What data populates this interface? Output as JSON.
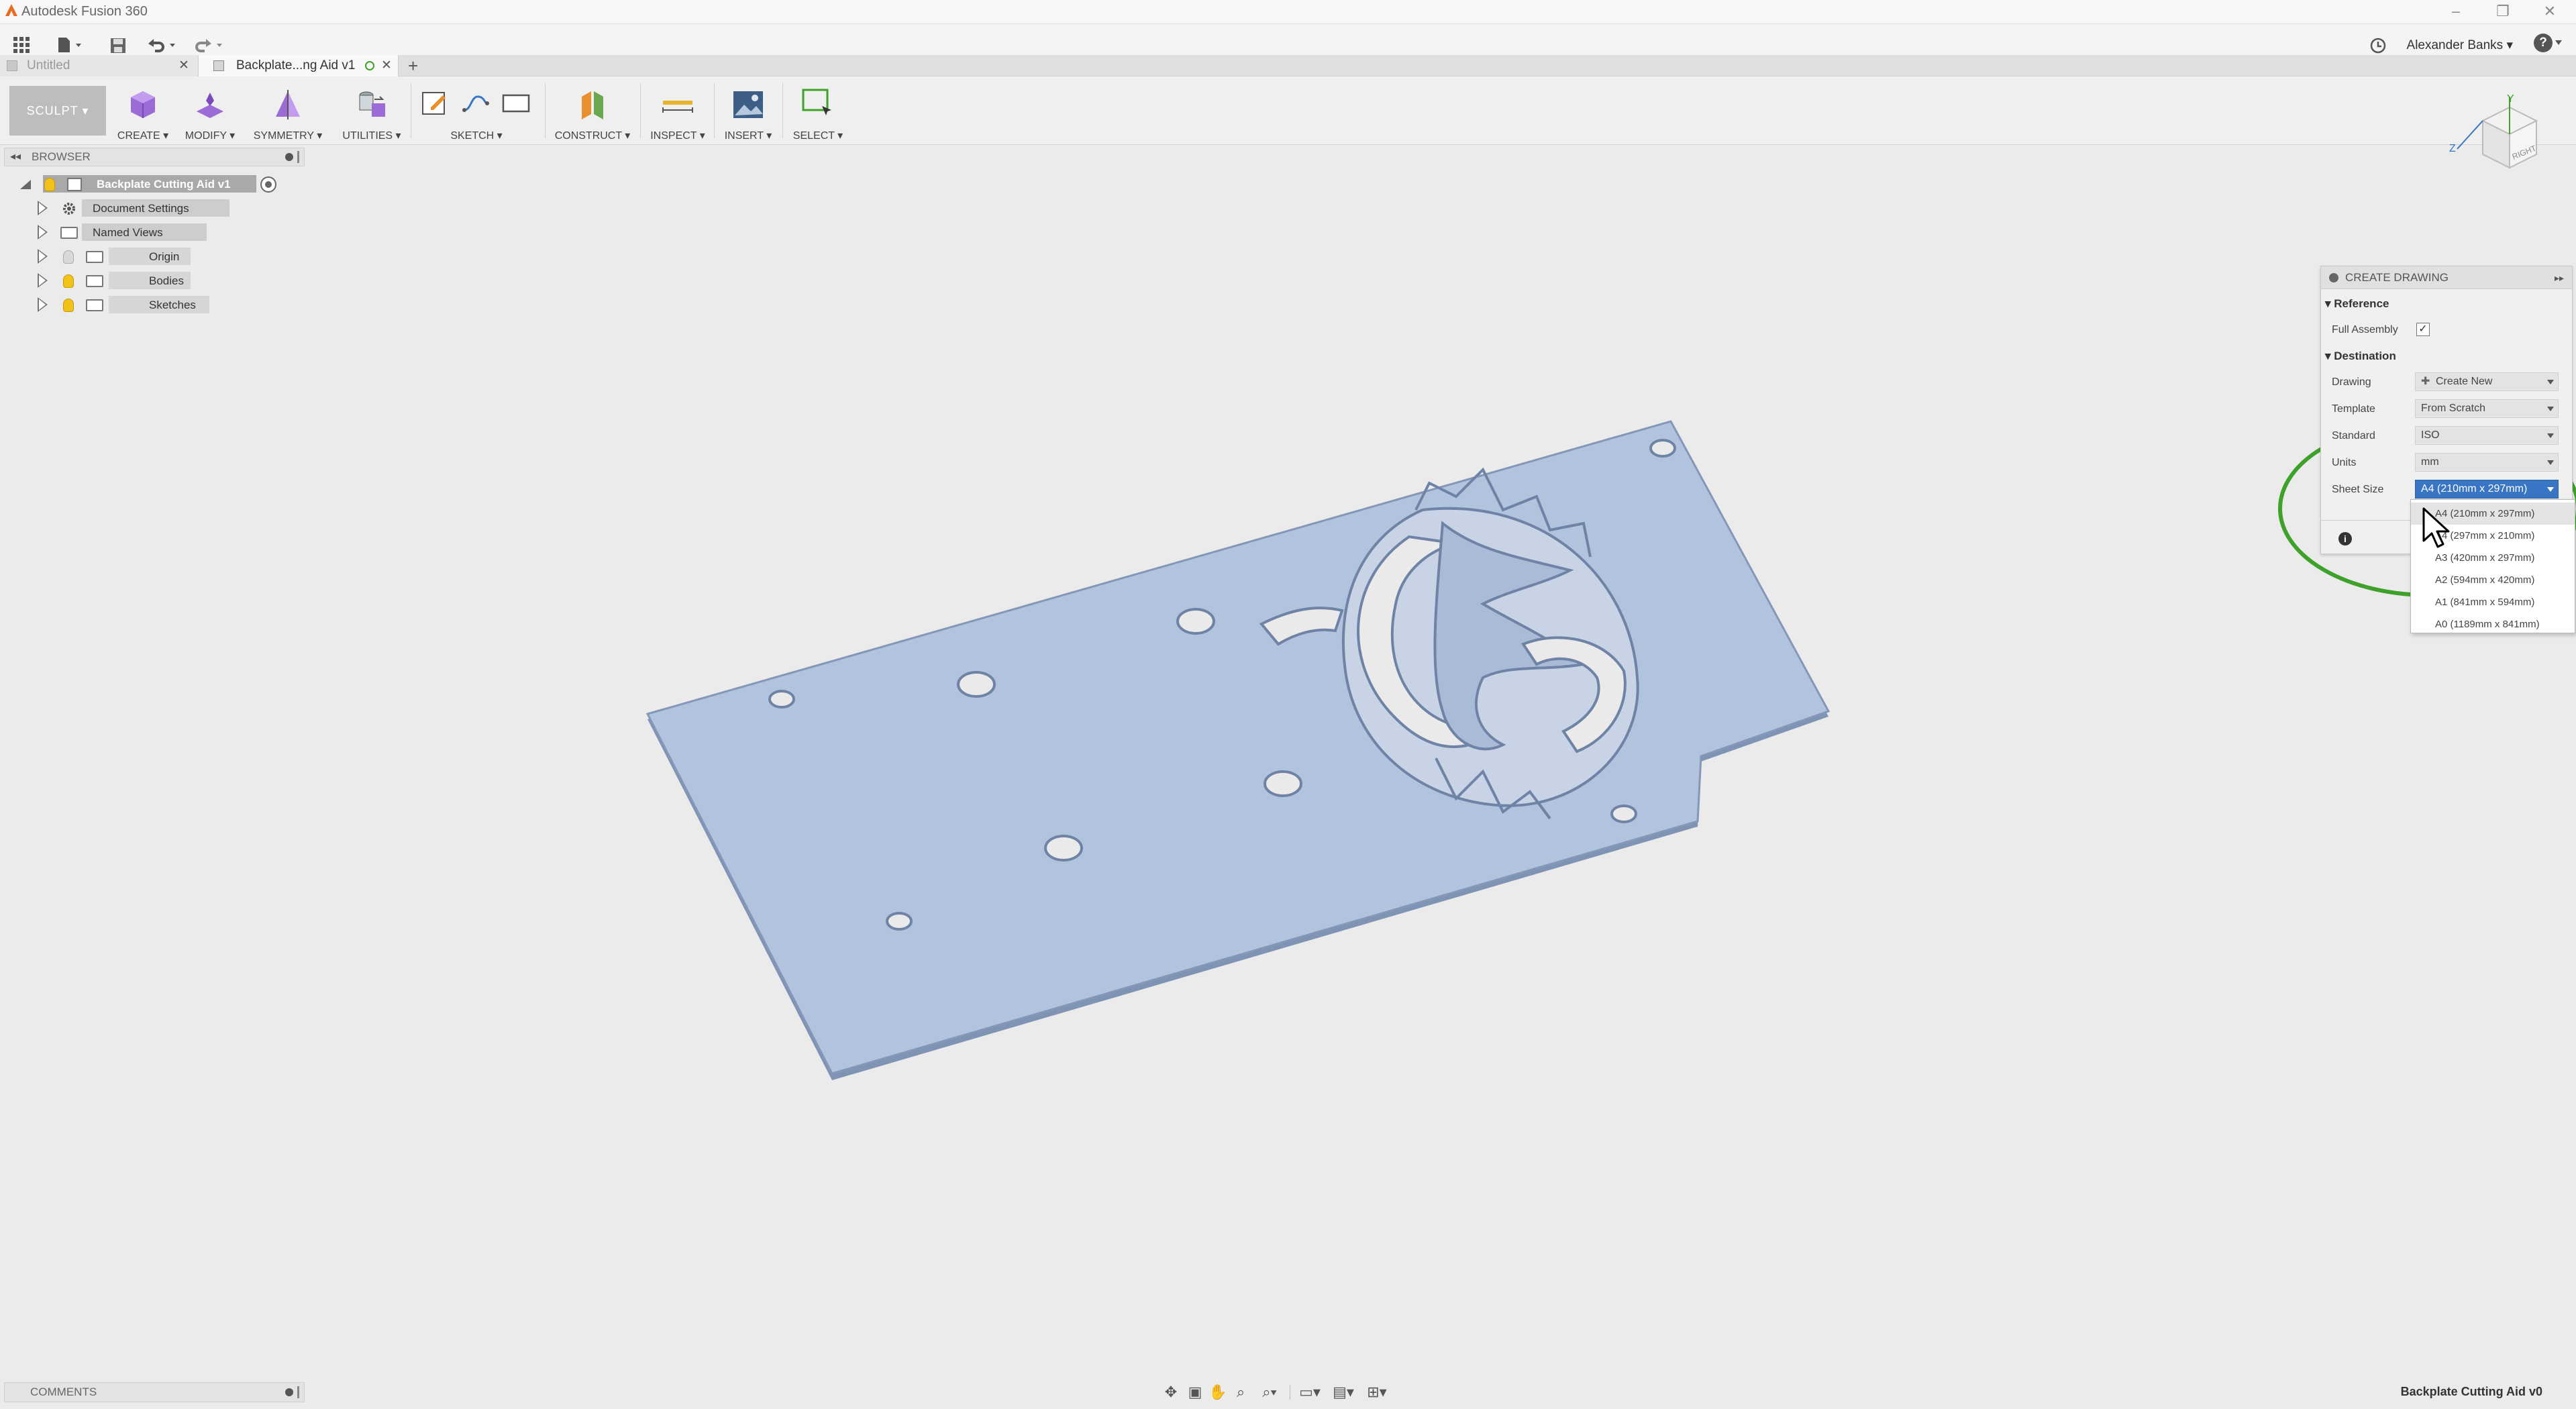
{
  "window": {
    "title": "Autodesk Fusion 360",
    "controls": [
      "–",
      "❐",
      "✕"
    ]
  },
  "quick_access": {
    "user_name": "Alexander Banks ▾",
    "help": "?"
  },
  "tabs": [
    {
      "label": "Untitled",
      "close": "✕"
    },
    {
      "label": "Backplate...ng Aid v1",
      "close": "✕"
    },
    {
      "label": "+"
    }
  ],
  "toolbar": {
    "workspace": "SCULPT ▾",
    "groups": [
      "CREATE ▾",
      "MODIFY ▾",
      "SYMMETRY ▾",
      "UTILITIES ▾",
      "SKETCH ▾",
      "CONSTRUCT ▾",
      "INSPECT ▾",
      "INSERT ▾",
      "SELECT ▾"
    ]
  },
  "browser": {
    "header": "BROWSER",
    "root": "Backplate Cutting Aid v1",
    "items": [
      {
        "label": "Document Settings",
        "icon": "gear-icon"
      },
      {
        "label": "Named Views",
        "icon": "folder-icon"
      },
      {
        "label": "Origin",
        "icon": "folder-icon"
      },
      {
        "label": "Bodies",
        "icon": "folder-icon"
      },
      {
        "label": "Sketches",
        "icon": "folder-icon"
      }
    ]
  },
  "viewcube": {
    "face_label": "RIGHT",
    "axes": [
      "Y",
      "Z"
    ]
  },
  "create_drawing": {
    "title": "CREATE DRAWING",
    "reference_section": "Reference",
    "full_assembly_label": "Full Assembly",
    "full_assembly_checked": true,
    "destination_section": "Destination",
    "drawing_label": "Drawing",
    "drawing_value": "Create New",
    "template_label": "Template",
    "template_value": "From Scratch",
    "standard_label": "Standard",
    "standard_value": "ISO",
    "units_label": "Units",
    "units_value": "mm",
    "sheet_size_label": "Sheet Size",
    "sheet_size_value": "A4 (210mm x 297mm)",
    "sheet_size_options": [
      "A4 (210mm x 297mm)",
      "A4 (297mm x 210mm)",
      "A3 (420mm x 297mm)",
      "A2 (594mm x 420mm)",
      "A1 (841mm x 594mm)",
      "A0 (1189mm x 841mm)"
    ],
    "highlight_color": "#3ea12a"
  },
  "bottom": {
    "comments": "COMMENTS",
    "document_name": "Backplate Cutting Aid v0"
  },
  "colors": {
    "model_fill": "#b2c3dd",
    "model_edge": "#7f93b5",
    "selected_blue": "#3875c5",
    "annotation_green": "#3ea12a"
  }
}
